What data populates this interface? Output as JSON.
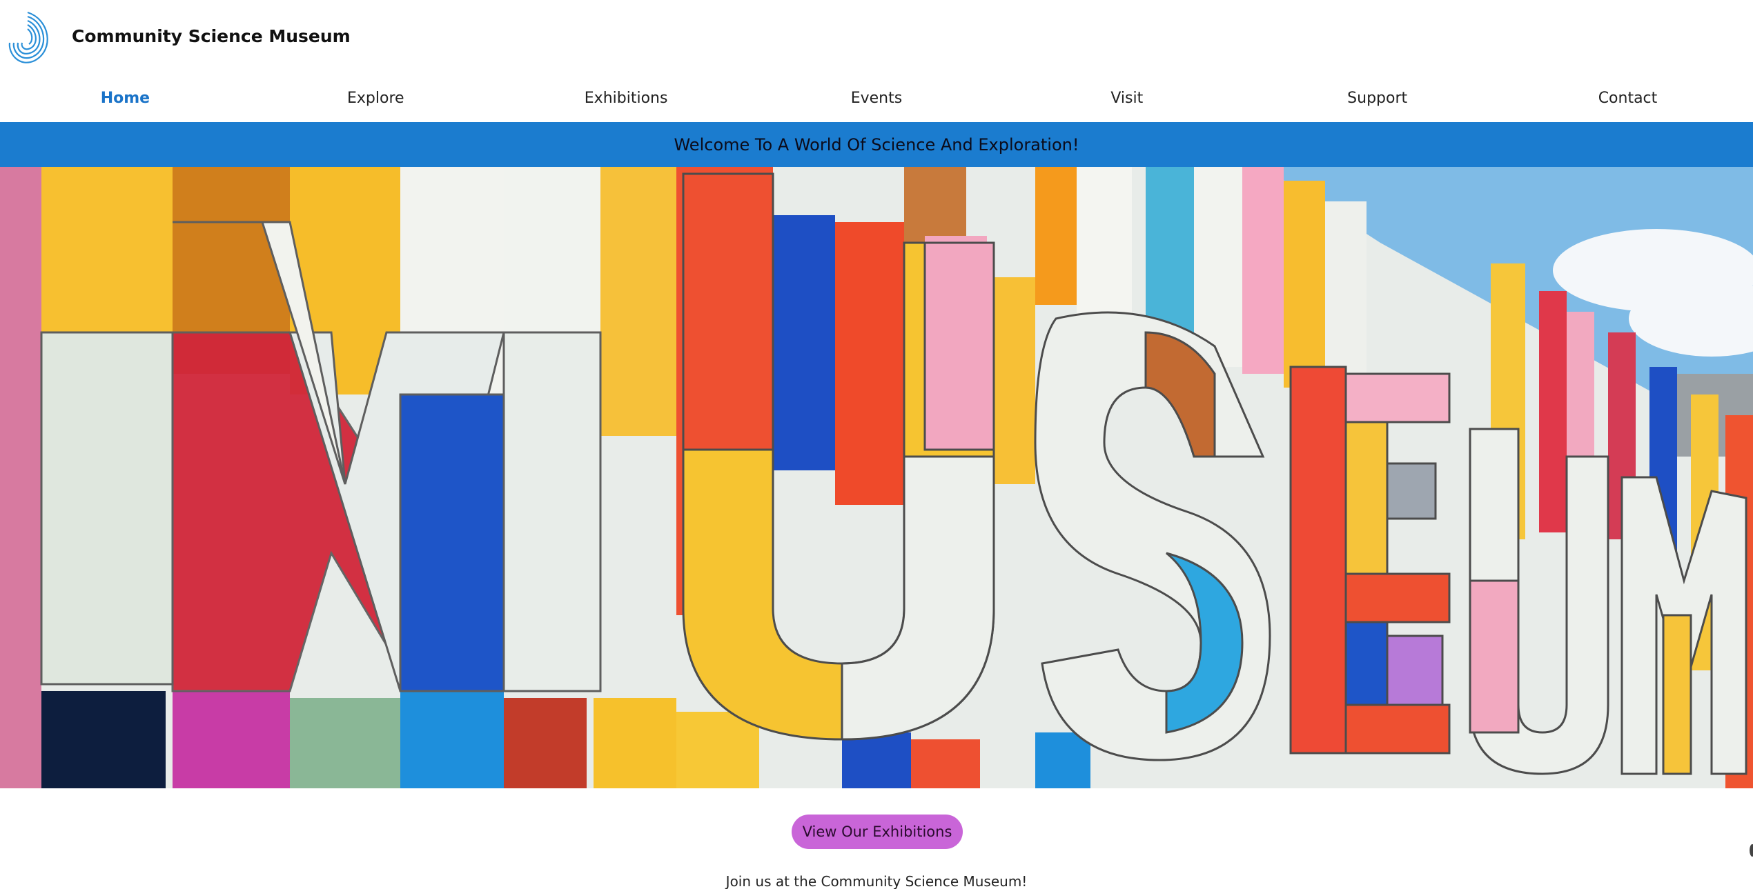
{
  "header": {
    "site_title": "Community Science Museum",
    "logo_icon": "spiral-logo-icon"
  },
  "nav": {
    "items": [
      {
        "label": "Home",
        "active": true
      },
      {
        "label": "Explore",
        "active": false
      },
      {
        "label": "Exhibitions",
        "active": false
      },
      {
        "label": "Events",
        "active": false
      },
      {
        "label": "Visit",
        "active": false
      },
      {
        "label": "Support",
        "active": false
      },
      {
        "label": "Contact",
        "active": false
      }
    ]
  },
  "banner": {
    "text": "Welcome To A World Of Science And Exploration!"
  },
  "hero": {
    "image_word": "MUSEUM"
  },
  "cta": {
    "label": "View Our Exhibitions"
  },
  "intro": {
    "text": "Join us at the Community Science Museum!"
  },
  "colors": {
    "accent": "#1a73c8",
    "banner_bg": "#1b7ccf",
    "cta_bg": "#c965d8"
  }
}
